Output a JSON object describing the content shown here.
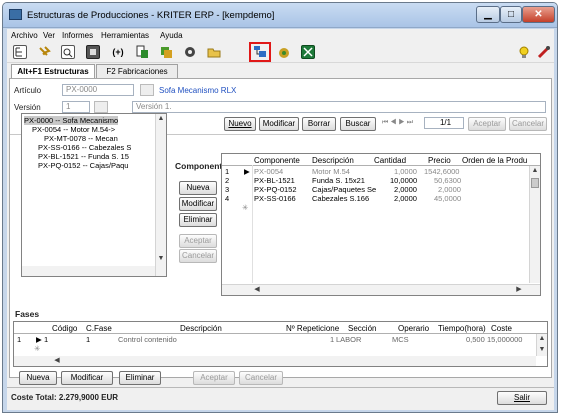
{
  "window": {
    "title": "Estructuras de Producciones - KRITER ERP - [kempdemo]",
    "controls": {
      "minimize": "▁",
      "maximize": "□",
      "close": "✕"
    }
  },
  "menu": [
    "Archivo",
    "Ver",
    "Informes",
    "Herramientas",
    "Ayuda"
  ],
  "toolbar": {
    "icons": [
      "tree-icon",
      "pin-icon",
      "preview-icon",
      "print-icon",
      "formula-icon",
      "document-icon",
      "component-icon",
      "gear-icon",
      "folder-icon",
      "structure-icon",
      "money-icon",
      "excel-icon"
    ],
    "right_icons": [
      "lightbulb-icon",
      "tools-icon"
    ],
    "highlight_color": "#e01818"
  },
  "tabs": [
    {
      "label": "Alt+F1 Estructuras",
      "active": true
    },
    {
      "label": "F2 Fabricaciones",
      "active": false
    }
  ],
  "header": {
    "articulo_label": "Artículo",
    "articulo_placeholder": "PX-0000",
    "articulo_desc": "Sofa Mecanismo RLX",
    "version_label": "Versión",
    "version_value": "1",
    "version_desc": "Versión 1."
  },
  "nav_buttons": {
    "nuevo": "Nuevo",
    "modificar": "Modificar",
    "borrar": "Borrar",
    "buscar": "Buscar",
    "record": "1/1",
    "aceptar": "Aceptar",
    "cancelar": "Cancelar"
  },
  "tree": [
    {
      "text": "PX-0000          -- Sofa Mecanismo",
      "indent": 0,
      "selected": true
    },
    {
      "text": "PX-0054          -- Motor M.54->",
      "indent": 1
    },
    {
      "text": "PX-MT-0078     -- Mecan",
      "indent": 2
    },
    {
      "text": "PX-SS-0166    -- Cabezales S",
      "indent": 1
    },
    {
      "text": "PX-BL-1521      -- Funda S. 15",
      "indent": 1
    },
    {
      "text": "PX-PQ-0152     -- Cajas/Paqu",
      "indent": 1
    }
  ],
  "componentes": {
    "title": "Componentes",
    "buttons": {
      "nueva": "Nueva",
      "modificar": "Modificar",
      "eliminar": "Eliminar",
      "aceptar": "Aceptar",
      "cancelar": "Cancelar"
    },
    "columns": [
      "Componente",
      "Descripción",
      "Cantidad",
      "Precio",
      "Orden de la Produ"
    ],
    "rows": [
      {
        "n": "1",
        "componente": "PX-0054",
        "descripcion": "Motor M.54",
        "cantidad": "1,0000",
        "precio": "1542,6000"
      },
      {
        "n": "2",
        "componente": "PX-BL-1521",
        "descripcion": "Funda S. 15x21",
        "cantidad": "10,0000",
        "precio": "50,6300"
      },
      {
        "n": "3",
        "componente": "PX-PQ-0152",
        "descripcion": "Cajas/Paquetes Se",
        "cantidad": "2,0000",
        "precio": "2,0000"
      },
      {
        "n": "4",
        "componente": "PX-SS-0166",
        "descripcion": "Cabezales S.166",
        "cantidad": "2,0000",
        "precio": "45,0000"
      }
    ]
  },
  "fases": {
    "title": "Fases",
    "columns": [
      "Código",
      "C.Fase",
      "Descripción",
      "Nº Repeticione",
      "Sección",
      "Operario",
      "Tiempo(hora)",
      "Coste"
    ],
    "rows": [
      {
        "n": "1",
        "codigo": "1",
        "cfase": "1",
        "descripcion": "Control contenido",
        "repeticiones": "1",
        "seccion": "LABOR",
        "operario": "MCS",
        "tiempo": "0,500",
        "coste": "15,000000"
      }
    ],
    "buttons": {
      "nueva": "Nueva",
      "modificar": "Modificar",
      "eliminar": "Eliminar",
      "aceptar": "Aceptar",
      "cancelar": "Cancelar"
    }
  },
  "status": {
    "coste_total": "Coste Total: 2.279,9000 EUR",
    "salir": "Salir"
  }
}
